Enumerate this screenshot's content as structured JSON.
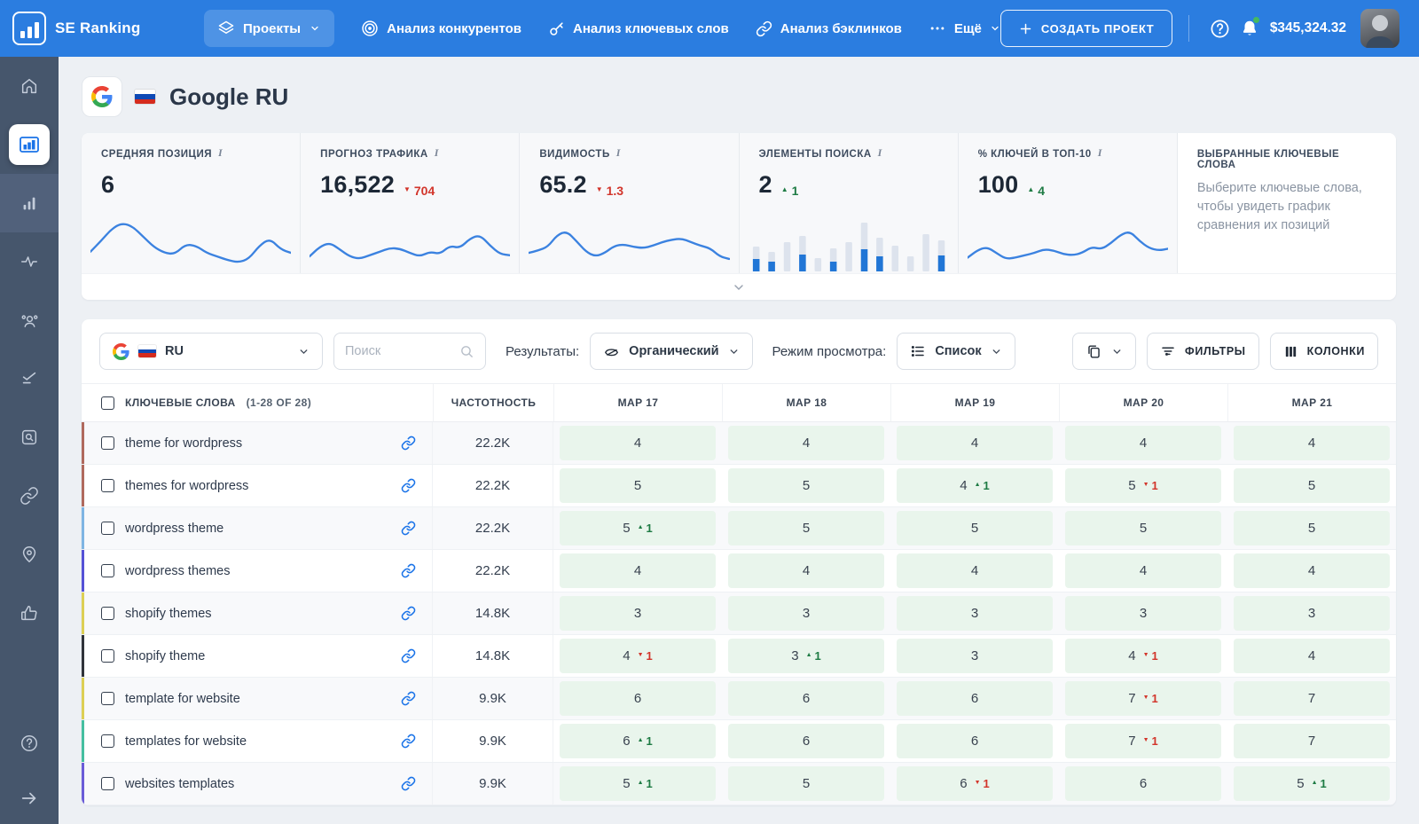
{
  "topbar": {
    "brand": "SE Ranking",
    "projects_label": "Проекты",
    "nav": [
      {
        "label": "Анализ конкурентов",
        "icon": "target-icon"
      },
      {
        "label": "Анализ ключевых слов",
        "icon": "key-icon"
      },
      {
        "label": "Анализ бэклинков",
        "icon": "link-icon"
      },
      {
        "label": "Ещё",
        "icon": "dots-icon"
      }
    ],
    "create_button": "СОЗДАТЬ ПРОЕКТ",
    "balance": "$345,324.32"
  },
  "sidebar": {
    "items": [
      {
        "icon": "home-icon"
      },
      {
        "icon": "projects-chart-icon",
        "active": true
      },
      {
        "icon": "rankings-bars-icon",
        "highlight": true
      },
      {
        "icon": "activity-icon"
      },
      {
        "icon": "competitors-users-icon"
      },
      {
        "icon": "audit-checks-icon"
      },
      {
        "icon": "search-square-icon"
      },
      {
        "icon": "backlinks-link-icon"
      },
      {
        "icon": "local-pin-icon"
      },
      {
        "icon": "social-thumb-icon"
      },
      {
        "icon": "help-icon"
      },
      {
        "icon": "expand-arrow-icon"
      }
    ]
  },
  "header": {
    "title": "Google RU"
  },
  "stats": {
    "cards": [
      {
        "label": "СРЕДНЯЯ ПОЗИЦИЯ",
        "value": "6",
        "chart": "line",
        "sparkline": [
          30,
          48,
          68,
          78,
          72,
          55,
          38,
          28,
          26,
          42,
          40,
          28,
          22,
          16,
          12,
          18,
          40,
          52,
          34,
          28
        ]
      },
      {
        "label": "ПРОГНОЗ ТРАФИКА",
        "value": "16,522",
        "change": "704",
        "dir": "down",
        "chart": "line",
        "sparkline": [
          22,
          38,
          45,
          34,
          22,
          18,
          24,
          30,
          36,
          35,
          28,
          22,
          30,
          26,
          40,
          36,
          52,
          58,
          40,
          26,
          24
        ]
      },
      {
        "label": "ВИДИМОСТЬ",
        "value": "65.2",
        "change": "1.3",
        "dir": "down",
        "chart": "line",
        "sparkline": [
          28,
          32,
          38,
          58,
          64,
          48,
          30,
          22,
          28,
          40,
          42,
          38,
          36,
          40,
          46,
          50,
          52,
          46,
          40,
          36,
          22,
          18
        ]
      },
      {
        "label": "ЭЛЕМЕНТЫ ПОИСКА",
        "value": "2",
        "change": "1",
        "dir": "up",
        "chart": "bars",
        "bars_total": [
          28,
          22,
          33,
          40,
          15,
          26,
          33,
          55,
          38,
          29,
          17,
          42,
          35
        ],
        "bars_blue": [
          14,
          11,
          0,
          19,
          0,
          11,
          0,
          25,
          17,
          0,
          0,
          0,
          18
        ]
      },
      {
        "label": "% КЛЮЧЕЙ В ТОП-10",
        "value": "100",
        "change": "4",
        "dir": "up",
        "chart": "line",
        "sparkline": [
          20,
          32,
          38,
          28,
          18,
          20,
          24,
          28,
          34,
          32,
          26,
          24,
          28,
          38,
          34,
          44,
          58,
          64,
          48,
          36,
          32,
          35
        ]
      },
      {
        "label": "ВЫБРАННЫЕ КЛЮЧЕВЫЕ СЛОВА",
        "chart": "none",
        "description": "Выберите ключевые слова, чтобы увидеть график сравнения их позиций"
      }
    ]
  },
  "toolbar": {
    "engine_label": "RU",
    "search_placeholder": "Поиск",
    "results_label": "Результаты:",
    "results_value": "Органический",
    "view_label": "Режим просмотра:",
    "view_value": "Список",
    "filters_button": "ФИЛЬТРЫ",
    "columns_button": "КОЛОНКИ"
  },
  "table": {
    "keyword_header": "КЛЮЧЕВЫЕ СЛОВА",
    "keyword_count": "(1-28 OF 28)",
    "volume_header": "ЧАСТОТНОСТЬ",
    "date_headers": [
      "МАР 17",
      "МАР 18",
      "МАР 19",
      "МАР 20",
      "МАР 21"
    ],
    "rows": [
      {
        "keyword": "theme for wordpress",
        "stripe": "#b06a5e",
        "volume": "22.2K",
        "cells": [
          {
            "v": 4,
            "diff": 0
          },
          {
            "v": 4,
            "diff": 0
          },
          {
            "v": 4,
            "diff": 0
          },
          {
            "v": 4,
            "diff": 0
          },
          {
            "v": 4,
            "diff": 0
          }
        ]
      },
      {
        "keyword": "themes for wordpress",
        "stripe": "#b06a5e",
        "volume": "22.2K",
        "cells": [
          {
            "v": 5,
            "diff": 0
          },
          {
            "v": 5,
            "diff": 0
          },
          {
            "v": 4,
            "diff": 1
          },
          {
            "v": 5,
            "diff": -1
          },
          {
            "v": 5,
            "diff": 0
          }
        ]
      },
      {
        "keyword": "wordpress theme",
        "stripe": "#7fb5e3",
        "volume": "22.2K",
        "cells": [
          {
            "v": 5,
            "diff": 1
          },
          {
            "v": 5,
            "diff": 0
          },
          {
            "v": 5,
            "diff": 0
          },
          {
            "v": 5,
            "diff": 0
          },
          {
            "v": 5,
            "diff": 0
          }
        ]
      },
      {
        "keyword": "wordpress themes",
        "stripe": "#5552d6",
        "volume": "22.2K",
        "cells": [
          {
            "v": 4,
            "diff": 0
          },
          {
            "v": 4,
            "diff": 0
          },
          {
            "v": 4,
            "diff": 0
          },
          {
            "v": 4,
            "diff": 0
          },
          {
            "v": 4,
            "diff": 0
          }
        ]
      },
      {
        "keyword": "shopify themes",
        "stripe": "#ddcf54",
        "volume": "14.8K",
        "cells": [
          {
            "v": 3,
            "diff": 0
          },
          {
            "v": 3,
            "diff": 0
          },
          {
            "v": 3,
            "diff": 0
          },
          {
            "v": 3,
            "diff": 0
          },
          {
            "v": 3,
            "diff": 0
          }
        ]
      },
      {
        "keyword": "shopify theme",
        "stripe": "#30333a",
        "volume": "14.8K",
        "cells": [
          {
            "v": 4,
            "diff": -1
          },
          {
            "v": 3,
            "diff": 1
          },
          {
            "v": 3,
            "diff": 0
          },
          {
            "v": 4,
            "diff": -1
          },
          {
            "v": 4,
            "diff": 0
          }
        ]
      },
      {
        "keyword": "template for website",
        "stripe": "#ddcf54",
        "volume": "9.9K",
        "cells": [
          {
            "v": 6,
            "diff": 0
          },
          {
            "v": 6,
            "diff": 0
          },
          {
            "v": 6,
            "diff": 0
          },
          {
            "v": 7,
            "diff": -1
          },
          {
            "v": 7,
            "diff": 0
          }
        ]
      },
      {
        "keyword": "templates for website",
        "stripe": "#45bfa0",
        "volume": "9.9K",
        "cells": [
          {
            "v": 6,
            "diff": 1
          },
          {
            "v": 6,
            "diff": 0
          },
          {
            "v": 6,
            "diff": 0
          },
          {
            "v": 7,
            "diff": -1
          },
          {
            "v": 7,
            "diff": 0
          }
        ]
      },
      {
        "keyword": "websites templates",
        "stripe": "#6a5cd8",
        "volume": "9.9K",
        "cells": [
          {
            "v": 5,
            "diff": 1
          },
          {
            "v": 5,
            "diff": 0
          },
          {
            "v": 6,
            "diff": -1
          },
          {
            "v": 6,
            "diff": 0
          },
          {
            "v": 5,
            "diff": 1
          }
        ]
      }
    ]
  },
  "colors": {
    "topbar": "#2b7de0",
    "sidebar": "#46566c",
    "accent_blue": "#2b7de0",
    "chip_green": "#e9f5ec",
    "up_green": "#1e7b44",
    "down_red": "#d2352b",
    "spark_blue": "#3b82e0"
  }
}
